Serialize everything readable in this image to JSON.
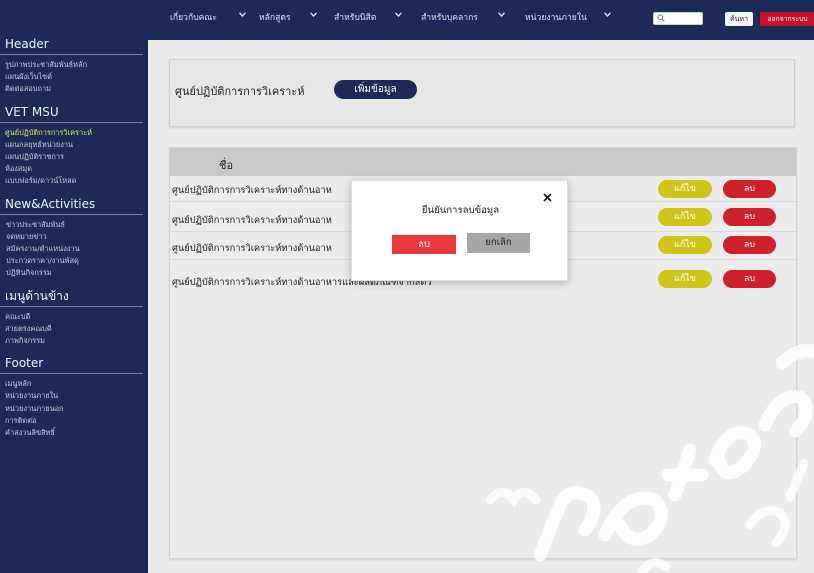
{
  "topnav": {
    "items": [
      {
        "label": "เกี่ยวกับคณะ"
      },
      {
        "label": "หลักสูตร"
      },
      {
        "label": "สำหรับนิสิต"
      },
      {
        "label": "สำหรับบุคลากร"
      },
      {
        "label": "หน่วยงานภายใน"
      }
    ],
    "search_placeholder": "",
    "search_label": "ค้นหา",
    "logout_label": "ออกจากระบบ"
  },
  "sidebar": {
    "sections": [
      {
        "title": "Header",
        "links": [
          "รูปภาพประชาสัมพันธ์หลัก",
          "แผนผังเว็บไซต์",
          "ติดต่อสอบถาม"
        ]
      },
      {
        "title": "VET MSU",
        "links": [
          "ศูนย์ปฏิบัติการการวิเคราะห์",
          "แผนกลยุทธ์หน่วยงาน",
          "แผนปฏิบัติราชการ",
          "ห้องสมุด",
          "แบบฟอร์ม/ดาวน์โหลด"
        ]
      },
      {
        "title": "New&Activities",
        "links": [
          "ข่าวประชาสัมพันธ์",
          "จดหมายข่าว",
          "สมัครงาน/ตำแหน่งงาน",
          "ประกวดราคา/งานพัสดุ",
          "ปฏิทินกิจกรรม"
        ]
      },
      {
        "title": "เมนูด้านข้าง",
        "links": [
          "คณะบดี",
          "สายตรงคณบดี",
          "ภาพกิจกรรม"
        ]
      },
      {
        "title": "Footer",
        "links": [
          "เมนูหลัก",
          "หน่วยงานภายใน",
          "หน่วยงานภายนอก",
          "การติดต่อ",
          "คำสงวนลิขสิทธิ์"
        ]
      }
    ],
    "active_link": "ศูนย์ปฏิบัติการการวิเคราะห์"
  },
  "page": {
    "title": "ศูนย์ปฏิบัติการการวิเคราะห์",
    "add_label": "เพิ่มข้อมูล"
  },
  "table": {
    "header": "ชื่อ",
    "rows": [
      {
        "name": "ศูนย์ปฏิบัติการการวิเคราะห์ทางด้านอาห",
        "edit": "แก้ไข",
        "delete": "ลบ"
      },
      {
        "name": "ศูนย์ปฏิบัติการการวิเคราะห์ทางด้านอาห",
        "edit": "แก้ไข",
        "delete": "ลบ"
      },
      {
        "name": "ศูนย์ปฏิบัติการการวิเคราะห์ทางด้านอาห",
        "edit": "แก้ไข",
        "delete": "ลบ"
      },
      {
        "name": "ศูนย์ปฏิบัติการการวิเคราะห์ทางด้านอาหารและผลิตภัณฑ์จากสัตว์",
        "edit": "แก้ไข",
        "delete": "ลบ"
      }
    ]
  },
  "modal": {
    "title": "ยืนยันการลบข้อมูล",
    "confirm_label": "ลบ",
    "cancel_label": "ยกเลิก"
  },
  "colors": {
    "navy": "#1d2a57",
    "active_link": "#e9e05a",
    "edit": "#cfc61b",
    "delete": "#d0202b",
    "confirm": "#e53a3e",
    "cancel": "#a6a6a6",
    "logout": "#c8102e"
  },
  "icons": [
    "chevron-down-icon",
    "search-icon",
    "close-icon"
  ]
}
